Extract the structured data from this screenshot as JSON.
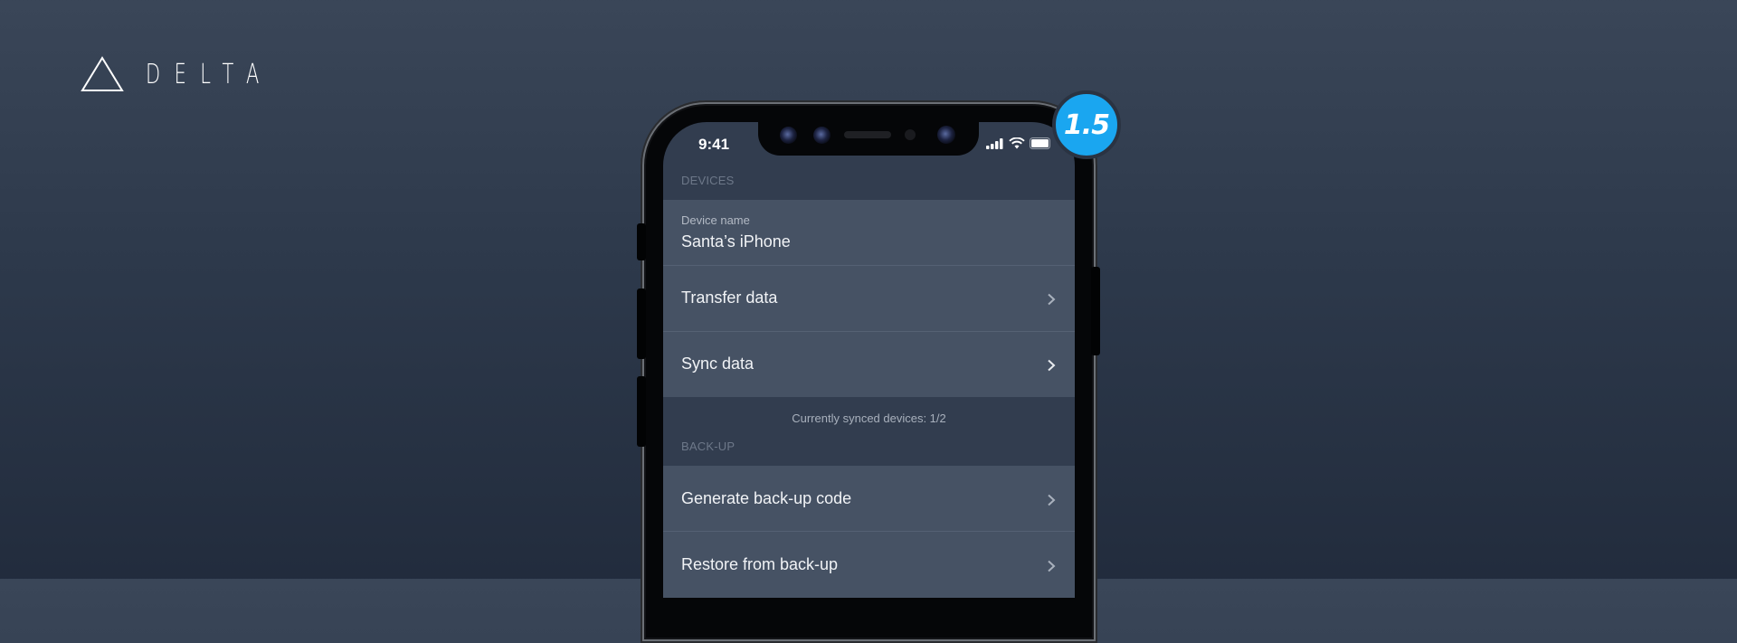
{
  "brand": {
    "name": "DELTA",
    "logo_icon": "triangle-outline-icon"
  },
  "version_badge": {
    "label": "1.5",
    "color": "#1aa6f0"
  },
  "phone": {
    "status_bar": {
      "time": "9:41",
      "icons": [
        "cellular-signal-icon",
        "wifi-icon",
        "battery-icon"
      ]
    },
    "sections": {
      "devices": {
        "header": "DEVICES",
        "device_name": {
          "label": "Device name",
          "value": "Santa’s iPhone"
        },
        "rows": [
          {
            "label": "Transfer data",
            "icon": "chevron-right-icon"
          },
          {
            "label": "Sync data",
            "icon": "chevron-right-icon"
          }
        ],
        "footnote": "Currently synced devices: 1/2"
      },
      "backup": {
        "header": "BACK-UP",
        "rows": [
          {
            "label": "Generate back-up code",
            "icon": "chevron-right-icon"
          },
          {
            "label": "Restore from back-up",
            "icon": "chevron-right-icon"
          }
        ]
      }
    }
  }
}
